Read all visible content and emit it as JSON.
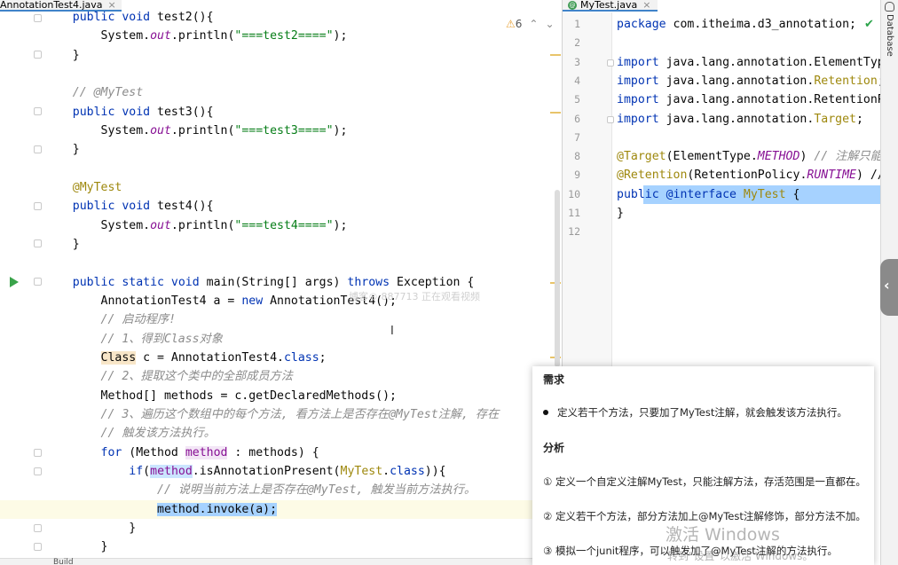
{
  "left_editor": {
    "tab_title": "AnnotationTest4.java",
    "tab_close": "×",
    "warnings": {
      "icon": "warning-triangle-icon",
      "count": "6",
      "up": "⌃",
      "down": "⌄"
    },
    "watermark_overlay": "博客® 887713 正在观看视频",
    "bottom_tab": "Build",
    "lines": [
      {
        "t": "public void test2(){",
        "segs": [
          [
            "    ",
            ""
          ],
          [
            "public void ",
            "kw"
          ],
          [
            "test2(){",
            ""
          ]
        ]
      },
      {
        "segs": [
          [
            "        System.",
            ""
          ],
          [
            "out",
            "fld"
          ],
          [
            ".println(",
            ""
          ],
          [
            "\"===test2====\"",
            "str"
          ],
          [
            ");",
            ""
          ]
        ]
      },
      {
        "segs": [
          [
            "    }",
            ""
          ]
        ]
      },
      {
        "segs": [
          [
            "",
            ""
          ]
        ]
      },
      {
        "segs": [
          [
            "    ",
            ""
          ],
          [
            "// @MyTest",
            "cmt"
          ]
        ]
      },
      {
        "segs": [
          [
            "    ",
            ""
          ],
          [
            "public void ",
            "kw"
          ],
          [
            "test3(){",
            ""
          ]
        ]
      },
      {
        "segs": [
          [
            "        System.",
            ""
          ],
          [
            "out",
            "fld"
          ],
          [
            ".println(",
            ""
          ],
          [
            "\"===test3====\"",
            "str"
          ],
          [
            ");",
            ""
          ]
        ]
      },
      {
        "segs": [
          [
            "    }",
            ""
          ]
        ]
      },
      {
        "segs": [
          [
            "",
            ""
          ]
        ]
      },
      {
        "segs": [
          [
            "    ",
            ""
          ],
          [
            "@MyTest",
            "ann"
          ]
        ]
      },
      {
        "segs": [
          [
            "    ",
            ""
          ],
          [
            "public void ",
            "kw"
          ],
          [
            "test4(){",
            ""
          ]
        ]
      },
      {
        "segs": [
          [
            "        System.",
            ""
          ],
          [
            "out",
            "fld"
          ],
          [
            ".println(",
            ""
          ],
          [
            "\"===test4====\"",
            "str"
          ],
          [
            ");",
            ""
          ]
        ]
      },
      {
        "segs": [
          [
            "    }",
            ""
          ]
        ]
      },
      {
        "segs": [
          [
            "",
            ""
          ]
        ]
      },
      {
        "segs": [
          [
            "    ",
            ""
          ],
          [
            "public static void ",
            "kw"
          ],
          [
            "main(String[] args) ",
            ""
          ],
          [
            "throws ",
            "kw"
          ],
          [
            "Exception {",
            ""
          ]
        ]
      },
      {
        "segs": [
          [
            "        AnnotationTest4 a = ",
            ""
          ],
          [
            "new ",
            "kw"
          ],
          [
            "AnnotationTest4();",
            ""
          ]
        ]
      },
      {
        "segs": [
          [
            "        ",
            ""
          ],
          [
            "// 启动程序!",
            "cmt"
          ]
        ]
      },
      {
        "segs": [
          [
            "        ",
            ""
          ],
          [
            "// 1、得到Class对象",
            "cmt"
          ]
        ]
      },
      {
        "segs": [
          [
            "        ",
            ""
          ],
          [
            "Class",
            "cls-hl"
          ],
          [
            " c = AnnotationTest4.",
            ""
          ],
          [
            "class",
            "kw"
          ],
          [
            ";",
            ""
          ]
        ]
      },
      {
        "segs": [
          [
            "        ",
            ""
          ],
          [
            "// 2、提取这个类中的全部成员方法",
            "cmt"
          ]
        ]
      },
      {
        "segs": [
          [
            "        Method[] methods = c.getDeclaredMethods();",
            ""
          ]
        ]
      },
      {
        "segs": [
          [
            "        ",
            ""
          ],
          [
            "// 3、遍历这个数组中的每个方法, 看方法上是否存在@MyTest注解, 存在",
            "cmt"
          ]
        ]
      },
      {
        "segs": [
          [
            "        ",
            ""
          ],
          [
            "// 触发该方法执行。",
            "cmt"
          ]
        ]
      },
      {
        "segs": [
          [
            "        ",
            ""
          ],
          [
            "for ",
            "kw"
          ],
          [
            "(Method ",
            ""
          ],
          [
            "method",
            "var var-hl"
          ],
          [
            " : methods) {",
            ""
          ]
        ]
      },
      {
        "segs": [
          [
            "            ",
            ""
          ],
          [
            "if",
            "kw"
          ],
          [
            "(",
            ""
          ],
          [
            "method",
            "var usage-hl"
          ],
          [
            ".isAnnotationPresent(",
            ""
          ],
          [
            "MyTest",
            "ann"
          ],
          [
            ".",
            ""
          ],
          [
            "class",
            "kw"
          ],
          [
            ")){",
            ""
          ]
        ]
      },
      {
        "segs": [
          [
            "                ",
            ""
          ],
          [
            "// 说明当前方法上是否存在@MyTest, 触发当前方法执行。",
            "cmt"
          ]
        ]
      },
      {
        "segs": [
          [
            "                ",
            ""
          ],
          [
            "method.invoke(a);",
            "sel"
          ]
        ]
      },
      {
        "segs": [
          [
            "            }",
            ""
          ]
        ]
      },
      {
        "segs": [
          [
            "        }",
            ""
          ]
        ]
      }
    ]
  },
  "right_editor": {
    "tab_title": "MyTest.java",
    "tab_icon": "@",
    "tab_close": "×",
    "status_icon": "✔",
    "line_numbers": [
      "1",
      "2",
      "3",
      "4",
      "5",
      "6",
      "7",
      "8",
      "9",
      "10",
      "11",
      "12"
    ],
    "lines": [
      {
        "segs": [
          [
            "package ",
            "kw"
          ],
          [
            "com.itheima.d3_annotation;",
            ""
          ]
        ]
      },
      {
        "segs": [
          [
            "",
            ""
          ]
        ]
      },
      {
        "segs": [
          [
            "import ",
            "kw"
          ],
          [
            "java.lang.annotation.ElementTyp",
            ""
          ]
        ]
      },
      {
        "segs": [
          [
            "import ",
            "kw"
          ],
          [
            "java.lang.annotation.",
            ""
          ],
          [
            "Retention",
            "ann"
          ],
          [
            ";",
            ""
          ]
        ]
      },
      {
        "segs": [
          [
            "import ",
            "kw"
          ],
          [
            "java.lang.annotation.RetentionP",
            ""
          ]
        ]
      },
      {
        "segs": [
          [
            "import ",
            "kw"
          ],
          [
            "java.lang.annotation.",
            ""
          ],
          [
            "Target",
            "ann"
          ],
          [
            ";",
            ""
          ]
        ]
      },
      {
        "segs": [
          [
            "",
            ""
          ]
        ]
      },
      {
        "segs": [
          [
            "@Target",
            "ann"
          ],
          [
            "(ElementType.",
            ""
          ],
          [
            "METHOD",
            "fld"
          ],
          [
            ") ",
            ""
          ],
          [
            "// 注解只能",
            "cmt"
          ]
        ]
      },
      {
        "segs": [
          [
            "@Retention",
            "ann"
          ],
          [
            "(RetentionPolicy.",
            ""
          ],
          [
            "RUNTIME",
            "fld"
          ],
          [
            ") //",
            ""
          ]
        ]
      },
      {
        "segs": [
          [
            "public ",
            "kw"
          ],
          [
            "@interface ",
            "kw"
          ],
          [
            "MyTest",
            "ann"
          ],
          [
            " {",
            ""
          ]
        ]
      },
      {
        "segs": [
          [
            "}",
            ""
          ]
        ]
      },
      {
        "segs": [
          [
            "",
            ""
          ]
        ]
      }
    ]
  },
  "sidebar": {
    "label": "Database",
    "icon": "database-icon",
    "collapse_glyph": "‹"
  },
  "notes": {
    "h1": "需求",
    "p1": "定义若干个方法，只要加了MyTest注解，就会触发该方法执行。",
    "h2": "分析",
    "p2": "① 定义一个自定义注解MyTest，只能注解方法，存活范围是一直都在。",
    "p3": "② 定义若干个方法，部分方法加上@MyTest注解修饰，部分方法不加。",
    "p4": "③ 模拟一个junit程序，可以触发加了@MyTest注解的方法执行。"
  },
  "activation": {
    "title": "激活 Windows",
    "subtitle": "转到\"设置\"以激活 Windows。"
  },
  "colors": {
    "keyword": "#0033b3",
    "string": "#067d17",
    "annotation": "#9e880d",
    "comment": "#8c8c8c",
    "selection": "#a6d2ff",
    "tab_underline": "#4083c9"
  }
}
